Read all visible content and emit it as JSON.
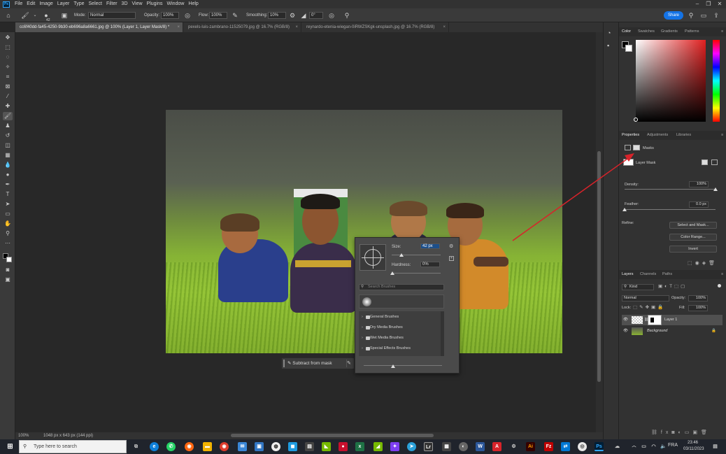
{
  "app": {
    "menu": [
      "File",
      "Edit",
      "Image",
      "Layer",
      "Type",
      "Select",
      "Filter",
      "3D",
      "View",
      "Plugins",
      "Window",
      "Help"
    ],
    "logo": "Ps"
  },
  "options": {
    "brush_size": "42",
    "mode_label": "Mode:",
    "mode_value": "Normal",
    "opacity_label": "Opacity:",
    "opacity_value": "100%",
    "flow_label": "Flow:",
    "flow_value": "100%",
    "smoothing_label": "Smoothing:",
    "smoothing_value": "10%",
    "angle_value": "0°",
    "share_label": "Share"
  },
  "tabs": [
    {
      "label": "cc6f40dd-fa45-4250-9b30-eb696a8a6661.jpg @ 100% (Layer 1, Layer Mask/8) *"
    },
    {
      "label": "pexels-luis-zambrano-11525079.jpg @ 16.7% (RGB/8)"
    },
    {
      "label": "reynardo-etenia-wiegan-0iRWZSKgk-unsplash.jpg @ 16.7% (RGB/8)"
    }
  ],
  "status": {
    "zoom": "100%",
    "doc_info": "1048 px x 643 px (144 ppi)"
  },
  "brush_popup": {
    "size_label": "Size:",
    "size_value": "42 px",
    "hardness_label": "Hardness:",
    "hardness_value": "0%",
    "search_placeholder": "Search Brushes",
    "folders": [
      "General Brushes",
      "Dry Media Brushes",
      "Wet Media Brushes",
      "Special Effects Brushes"
    ]
  },
  "mask_bar": {
    "label": "Subtract from mask"
  },
  "color_panel": {
    "tabs": [
      "Color",
      "Swatches",
      "Gradients",
      "Patterns"
    ]
  },
  "properties_panel": {
    "tabs": [
      "Properties",
      "Adjustments",
      "Libraries"
    ],
    "masks_label": "Masks",
    "layer_mask_label": "Layer Mask",
    "density_label": "Density:",
    "density_value": "100%",
    "density_level": 1.0,
    "feather_label": "Feather:",
    "feather_value": "0.0 px",
    "feather_level": 0.0,
    "refine_label": "Refine:",
    "select_mask_button": "Select and Mask...",
    "color_range_button": "Color Range...",
    "invert_button": "Invert"
  },
  "layers_panel": {
    "tabs": [
      "Layers",
      "Channels",
      "Paths"
    ],
    "filter_label": "Kind",
    "blend_mode": "Normal",
    "opacity_label": "Opacity:",
    "opacity_value": "100%",
    "lock_label": "Lock:",
    "fill_label": "Fill:",
    "fill_value": "100%",
    "layers": [
      {
        "name": "Layer 1"
      },
      {
        "name": "Background"
      }
    ]
  },
  "taskbar": {
    "search_placeholder": "Type here to search",
    "language": "FRA",
    "time": "23:46",
    "date": "03/11/2023"
  }
}
